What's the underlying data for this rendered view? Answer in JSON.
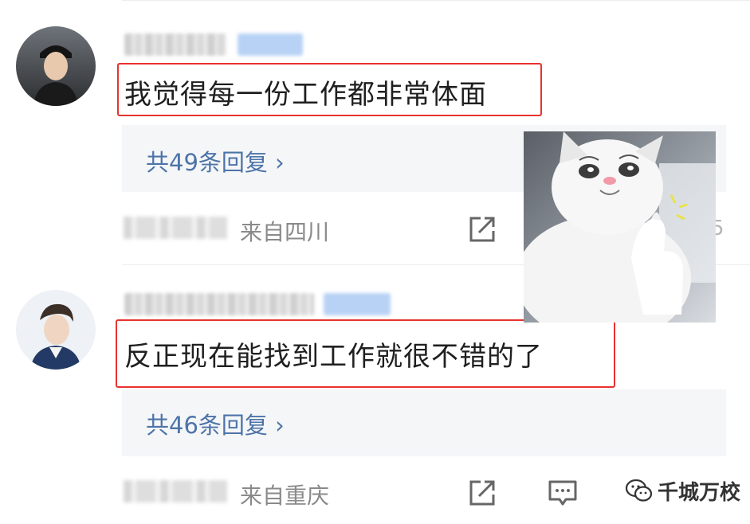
{
  "comments": [
    {
      "text": "我觉得每一份工作都非常体面",
      "replies_label": "共49条回复 ›",
      "location": "来自四川"
    },
    {
      "text": "反正现在能找到工作就很不错的了",
      "replies_label": "共46条回复 ›",
      "location": "来自重庆"
    }
  ],
  "stray_count": "5",
  "watermark": "千城万校",
  "colors": {
    "highlight_border": "#e8322e",
    "reply_link": "#4d74a8",
    "reply_bg": "#f5f6f8",
    "muted": "#8a8a8a"
  },
  "icons": [
    "share-icon",
    "comment-icon",
    "wechat-logo-icon"
  ]
}
